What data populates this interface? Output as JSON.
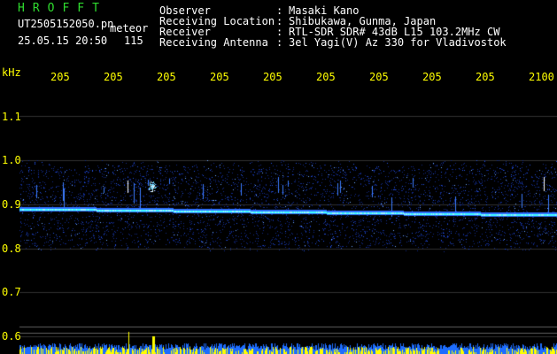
{
  "logo": "HROFFT",
  "header_left": {
    "filename": "UT2505152050.pn",
    "meteor_label": "meteor",
    "datetime": "25.05.15 20:50",
    "count": "115"
  },
  "station_info": [
    {
      "label": "Observer",
      "value": "Masaki Kano"
    },
    {
      "label": "Receiving Location",
      "value": "Shibukawa, Gunma, Japan"
    },
    {
      "label": "Receiver",
      "value": "RTL-SDR SDR# 43dB L15 103.2MHz CW"
    },
    {
      "label": "Receiving Antenna",
      "value": "3el Yagi(V) Az 330 for Vladivostok"
    }
  ],
  "y_axis": {
    "unit": "kHz",
    "ticks": [
      "1.1",
      "1.0",
      "0.9",
      "0.8",
      "0.7",
      "0.6"
    ]
  },
  "x_axis": {
    "ticks": [
      "205",
      "205",
      "205",
      "205",
      "205",
      "205",
      "205",
      "205",
      "205",
      "2100"
    ]
  },
  "colors": {
    "background": "#000000",
    "text_primary": "#ffffff",
    "logo": "#2fdc2f",
    "axis_text": "#ffff00",
    "noise": "#1a3cc8",
    "carrier": "#40ffff"
  }
}
